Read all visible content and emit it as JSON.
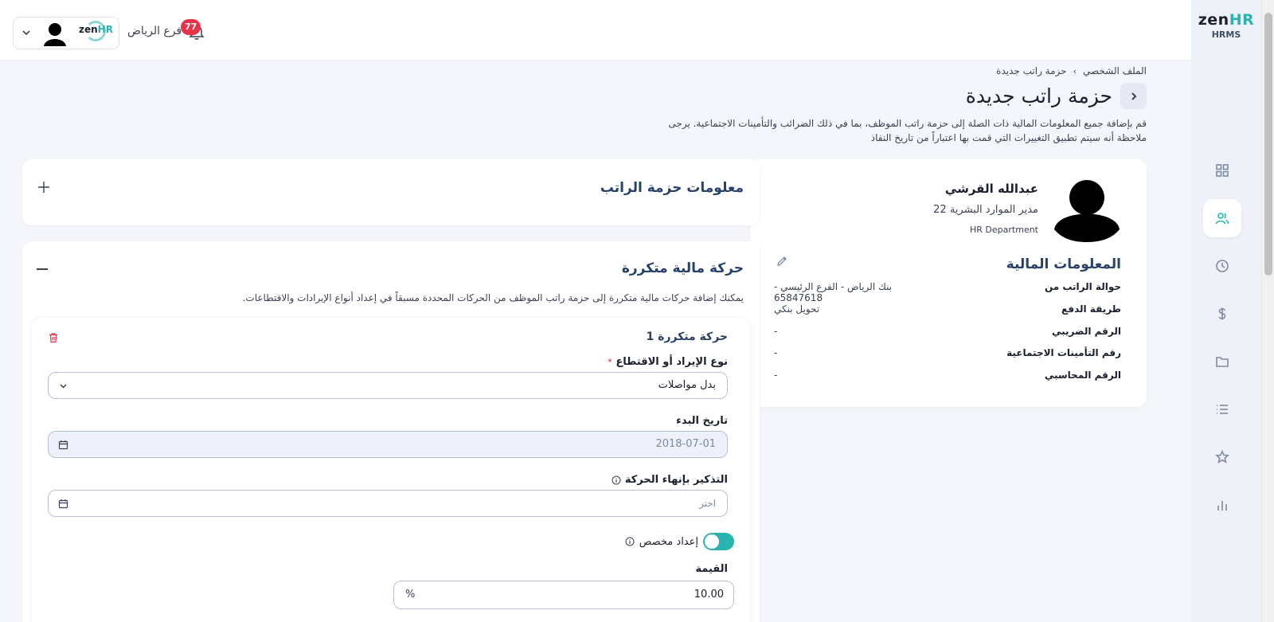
{
  "brand": {
    "logo_main": "zen",
    "logo_accent": "HR",
    "sub": "HRMS"
  },
  "topbar": {
    "branch": "فرع الرياض",
    "notifications_count": "77",
    "mini_logo_main": "zen",
    "mini_logo_accent": "HR"
  },
  "breadcrumb": {
    "items": [
      "الملف الشخصي",
      "حزمة راتب جديدة"
    ],
    "separator": "›"
  },
  "page": {
    "title": "حزمة راتب جديدة",
    "description": "قم بإضافة جميع المعلومات المالية ذات الصلة إلى حزمة راتب الموظف، بما في ذلك الضرائب والتأمينات الاجتماعية. يرجى ملاحظة أنه سيتم تطبيق التغييرات التي قمت بها اعتباراً من تاريخ النفاذ"
  },
  "employee": {
    "name": "عبدالله القرشي",
    "job_title": "مدير الموارد البشرية 22",
    "department": "HR Department",
    "financial_title": "المعلومات المالية",
    "rows": [
      {
        "label": "حوالة الراتب من",
        "value": "بنك الرياض - الفرع الرئيسي - 65847618"
      },
      {
        "label": "طريقة الدفع",
        "value": "تحويل بنكي"
      },
      {
        "label": "الرقم الضريبي",
        "value": "-"
      },
      {
        "label": "رقم التأمينات الاجتماعية",
        "value": "-"
      },
      {
        "label": "الرقم المحاسبي",
        "value": "-"
      }
    ]
  },
  "salary_info": {
    "title": "معلومات حزمة الراتب"
  },
  "recurring": {
    "title": "حركة مالية متكررة",
    "description": "يمكنك إضافة حركات مالية متكررة إلى حزمة راتب الموظف من الحركات المحددة مسبقاً في إعداد أنواع الإيرادات والاقتطاعات.",
    "item": {
      "title": "حركة متكررة 1",
      "type_label": "نوع الإيراد أو الاقتطاع",
      "required_mark": "*",
      "type_value": "بدل مواصلات",
      "start_label": "تاريخ البدء",
      "start_value": "2018-07-01",
      "reminder_label": "التذكير بإنهاء الحركة",
      "reminder_placeholder": "اختر",
      "custom_label": "إعداد مخصص",
      "amount_label": "القيمة",
      "amount_value": "10.00",
      "amount_unit": "%"
    }
  },
  "colors": {
    "accent": "#2bb3b1",
    "badge": "#e8334a",
    "title_blue": "#27416a"
  },
  "rail_icons": [
    "grid-icon",
    "users-icon",
    "clock-icon",
    "dollar-icon",
    "folder-icon",
    "list-icon",
    "star-icon",
    "bar-chart-icon"
  ]
}
